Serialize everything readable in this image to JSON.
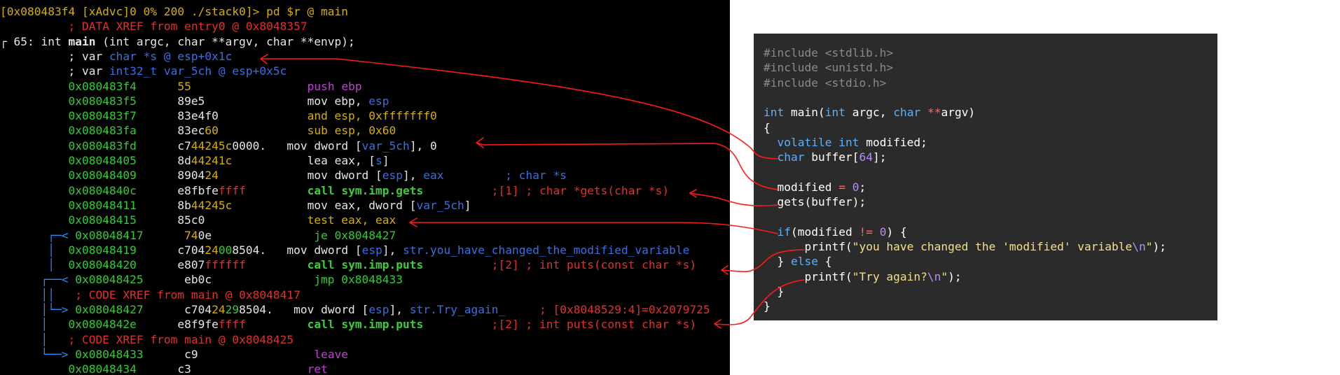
{
  "colors": {
    "terminal_bg": "#000000",
    "code_bg": "#2b2b2b",
    "annotation_red": "#ff1a1a",
    "flow_arrow_blue": "#1e90ff",
    "address_green": "#32cd32",
    "prompt_yellow": "#d7af00",
    "comment_red": "#e0312d",
    "keyword_blue": "#5fafff",
    "mnemonic_purple": "#c040d0",
    "call_green": "#3ccc3c"
  },
  "terminal": {
    "lines": [
      [
        {
          "t": "[0x080483f4 [xAdvc]0 0% 200 ./stack0]> pd $r @ main",
          "c": "#d7af00"
        }
      ],
      [
        {
          "t": "          ",
          "c": "#e6e6e6"
        },
        {
          "t": "; DATA XREF from entry0 @ 0x8048357",
          "c": "#e0312d"
        }
      ],
      [
        {
          "t": "┌ 65: int ",
          "c": "#e6e6e6"
        },
        {
          "t": "main",
          "c": "#e6e6e6",
          "b": true
        },
        {
          "t": " (int argc, char **argv, char **envp);",
          "c": "#e6e6e6"
        }
      ],
      [
        {
          "t": "          ; var ",
          "c": "#e6e6e6"
        },
        {
          "t": "char *s @ esp+0x1c",
          "c": "#3a6fe0"
        }
      ],
      [
        {
          "t": "          ; var ",
          "c": "#e6e6e6"
        },
        {
          "t": "int32_t var_5ch @ esp+0x5c",
          "c": "#3a6fe0"
        }
      ],
      [
        {
          "t": "          ",
          "c": "#e6e6e6"
        },
        {
          "t": "0x080483f4      ",
          "c": "#32cd32"
        },
        {
          "t": "55",
          "c": "#d7af00"
        },
        {
          "t": "                 ",
          "c": "#e6e6e6"
        },
        {
          "t": "push ebp",
          "c": "#c040d0"
        }
      ],
      [
        {
          "t": "          ",
          "c": "#e6e6e6"
        },
        {
          "t": "0x080483f5      ",
          "c": "#32cd32"
        },
        {
          "t": "89e5               mov ebp, ",
          "c": "#e6e6e6"
        },
        {
          "t": "esp",
          "c": "#3a6fe0"
        }
      ],
      [
        {
          "t": "          ",
          "c": "#e6e6e6"
        },
        {
          "t": "0x080483f7      ",
          "c": "#32cd32"
        },
        {
          "t": "83e4f0             ",
          "c": "#e6e6e6"
        },
        {
          "t": "and esp, 0xfffffff0",
          "c": "#d7af00"
        }
      ],
      [
        {
          "t": "          ",
          "c": "#e6e6e6"
        },
        {
          "t": "0x080483fa      ",
          "c": "#32cd32"
        },
        {
          "t": "83ec",
          "c": "#e6e6e6"
        },
        {
          "t": "60",
          "c": "#d7af00"
        },
        {
          "t": "             ",
          "c": "#e6e6e6"
        },
        {
          "t": "sub esp, 0x60",
          "c": "#d7af00"
        }
      ],
      [
        {
          "t": "          ",
          "c": "#e6e6e6"
        },
        {
          "t": "0x080483fd      ",
          "c": "#32cd32"
        },
        {
          "t": "c7",
          "c": "#e6e6e6"
        },
        {
          "t": "44245c",
          "c": "#d7af00"
        },
        {
          "t": "0000.",
          "c": "#e6e6e6"
        },
        {
          "t": "   mov dword [",
          "c": "#e6e6e6"
        },
        {
          "t": "var_5ch",
          "c": "#3a6fe0"
        },
        {
          "t": "], 0",
          "c": "#e6e6e6"
        }
      ],
      [
        {
          "t": "          ",
          "c": "#e6e6e6"
        },
        {
          "t": "0x08048405      ",
          "c": "#32cd32"
        },
        {
          "t": "8d",
          "c": "#e6e6e6"
        },
        {
          "t": "44241c",
          "c": "#d7af00"
        },
        {
          "t": "           lea eax, [",
          "c": "#e6e6e6"
        },
        {
          "t": "s",
          "c": "#3a6fe0"
        },
        {
          "t": "]",
          "c": "#e6e6e6"
        }
      ],
      [
        {
          "t": "          ",
          "c": "#e6e6e6"
        },
        {
          "t": "0x08048409      ",
          "c": "#32cd32"
        },
        {
          "t": "8904",
          "c": "#e6e6e6"
        },
        {
          "t": "24",
          "c": "#d7af00"
        },
        {
          "t": "             mov dword [",
          "c": "#e6e6e6"
        },
        {
          "t": "esp",
          "c": "#3a6fe0"
        },
        {
          "t": "], ",
          "c": "#e6e6e6"
        },
        {
          "t": "eax",
          "c": "#3a6fe0"
        },
        {
          "t": "         ",
          "c": "#e6e6e6"
        },
        {
          "t": "; char *s",
          "c": "#3a6fe0"
        }
      ],
      [
        {
          "t": "          ",
          "c": "#e6e6e6"
        },
        {
          "t": "0x0804840c      ",
          "c": "#32cd32"
        },
        {
          "t": "e8fbfe",
          "c": "#e6e6e6"
        },
        {
          "t": "ffff",
          "c": "#e0312d"
        },
        {
          "t": "         ",
          "c": "#e6e6e6"
        },
        {
          "t": "call sym.imp.gets",
          "c": "#3ccc3c",
          "b": true
        },
        {
          "t": "          ",
          "c": "#e6e6e6"
        },
        {
          "t": ";[1] ; char *gets(char *s)",
          "c": "#e0312d"
        }
      ],
      [
        {
          "t": "          ",
          "c": "#e6e6e6"
        },
        {
          "t": "0x08048411      ",
          "c": "#32cd32"
        },
        {
          "t": "8b",
          "c": "#e6e6e6"
        },
        {
          "t": "44245c",
          "c": "#d7af00"
        },
        {
          "t": "           mov eax, dword [",
          "c": "#e6e6e6"
        },
        {
          "t": "var_5ch",
          "c": "#3a6fe0"
        },
        {
          "t": "]",
          "c": "#e6e6e6"
        }
      ],
      [
        {
          "t": "          ",
          "c": "#e6e6e6"
        },
        {
          "t": "0x08048415      ",
          "c": "#32cd32"
        },
        {
          "t": "85c0",
          "c": "#e6e6e6"
        },
        {
          "t": "               ",
          "c": "#e6e6e6"
        },
        {
          "t": "test eax, eax",
          "c": "#d7af00"
        }
      ],
      [
        {
          "t": "       ┌─< ",
          "c": "#1e90ff"
        },
        {
          "t": "0x08048417      ",
          "c": "#32cd32"
        },
        {
          "t": "74",
          "c": "#d7af00"
        },
        {
          "t": "0e",
          "c": "#e6e6e6"
        },
        {
          "t": "               ",
          "c": "#e6e6e6"
        },
        {
          "t": "je 0x8048427",
          "c": "#32cd32"
        }
      ],
      [
        {
          "t": "       │  ",
          "c": "#1e90ff"
        },
        {
          "t": "0x08048419      ",
          "c": "#32cd32"
        },
        {
          "t": "c704",
          "c": "#e6e6e6"
        },
        {
          "t": "24",
          "c": "#d7af00"
        },
        {
          "t": "00",
          "c": "#32cd32"
        },
        {
          "t": "8504.",
          "c": "#e6e6e6"
        },
        {
          "t": "   mov dword [",
          "c": "#e6e6e6"
        },
        {
          "t": "esp",
          "c": "#3a6fe0"
        },
        {
          "t": "], ",
          "c": "#e6e6e6"
        },
        {
          "t": "str.you_have_changed_the_modified_variable",
          "c": "#3a6fe0"
        }
      ],
      [
        {
          "t": "       │  ",
          "c": "#1e90ff"
        },
        {
          "t": "0x08048420      ",
          "c": "#32cd32"
        },
        {
          "t": "e807",
          "c": "#e6e6e6"
        },
        {
          "t": "ffffff",
          "c": "#e0312d"
        },
        {
          "t": "         ",
          "c": "#e6e6e6"
        },
        {
          "t": "call sym.imp.puts",
          "c": "#3ccc3c",
          "b": true
        },
        {
          "t": "          ",
          "c": "#e6e6e6"
        },
        {
          "t": ";[2] ; int puts(const char *s)",
          "c": "#e0312d"
        }
      ],
      [
        {
          "t": "      ┌──< ",
          "c": "#1e90ff"
        },
        {
          "t": "0x08048425      ",
          "c": "#32cd32"
        },
        {
          "t": "eb0c",
          "c": "#e6e6e6"
        },
        {
          "t": "               ",
          "c": "#e6e6e6"
        },
        {
          "t": "jmp 0x8048433",
          "c": "#32cd32"
        }
      ],
      [
        {
          "t": "      ││   ",
          "c": "#1e90ff"
        },
        {
          "t": "; CODE XREF from main @ 0x8048417",
          "c": "#e0312d"
        }
      ],
      [
        {
          "t": "      │└─> ",
          "c": "#1e90ff"
        },
        {
          "t": "0x08048427      ",
          "c": "#32cd32"
        },
        {
          "t": "c704",
          "c": "#e6e6e6"
        },
        {
          "t": "24",
          "c": "#d7af00"
        },
        {
          "t": "29",
          "c": "#32cd32"
        },
        {
          "t": "8504.",
          "c": "#e6e6e6"
        },
        {
          "t": "   mov dword [",
          "c": "#e6e6e6"
        },
        {
          "t": "esp",
          "c": "#3a6fe0"
        },
        {
          "t": "], ",
          "c": "#e6e6e6"
        },
        {
          "t": "str.Try_again_",
          "c": "#3a6fe0"
        },
        {
          "t": "     ",
          "c": "#e6e6e6"
        },
        {
          "t": "; [0x8048529:4]=0x2079725",
          "c": "#e0312d"
        }
      ],
      [
        {
          "t": "      │   ",
          "c": "#1e90ff"
        },
        {
          "t": "0x0804842e      ",
          "c": "#32cd32"
        },
        {
          "t": "e8f9fe",
          "c": "#e6e6e6"
        },
        {
          "t": "ffff",
          "c": "#e0312d"
        },
        {
          "t": "         ",
          "c": "#e6e6e6"
        },
        {
          "t": "call sym.imp.puts",
          "c": "#3ccc3c",
          "b": true
        },
        {
          "t": "          ",
          "c": "#e6e6e6"
        },
        {
          "t": ";[2] ; int puts(const char *s)",
          "c": "#e0312d"
        }
      ],
      [
        {
          "t": "      │   ",
          "c": "#1e90ff"
        },
        {
          "t": "; CODE XREF from main @ 0x8048425",
          "c": "#e0312d"
        }
      ],
      [
        {
          "t": "      └──> ",
          "c": "#1e90ff"
        },
        {
          "t": "0x08048433      ",
          "c": "#32cd32"
        },
        {
          "t": "c9",
          "c": "#e6e6e6"
        },
        {
          "t": "                 ",
          "c": "#e6e6e6"
        },
        {
          "t": "leave",
          "c": "#c040d0"
        }
      ],
      [
        {
          "t": "          ",
          "c": "#e6e6e6"
        },
        {
          "t": "0x08048434      ",
          "c": "#32cd32"
        },
        {
          "t": "c3",
          "c": "#e6e6e6"
        },
        {
          "t": "                 ",
          "c": "#e6e6e6"
        },
        {
          "t": "ret",
          "c": "#c040d0"
        }
      ]
    ]
  },
  "source_code": {
    "lines": [
      [
        {
          "t": "#include <stdlib.h>",
          "c": "#8a8a8a"
        }
      ],
      [
        {
          "t": "#include <unistd.h>",
          "c": "#8a8a8a"
        }
      ],
      [
        {
          "t": "#include <stdio.h>",
          "c": "#8a8a8a"
        }
      ],
      [
        {
          "t": "",
          "c": "#ffffff"
        }
      ],
      [
        {
          "t": "int",
          "c": "#5fafff"
        },
        {
          "t": " main(",
          "c": "#ffffff"
        },
        {
          "t": "int",
          "c": "#5fafff"
        },
        {
          "t": " argc, ",
          "c": "#ffffff"
        },
        {
          "t": "char",
          "c": "#5fafff"
        },
        {
          "t": " ",
          "c": "#ffffff"
        },
        {
          "t": "**",
          "c": "#ff6a6a"
        },
        {
          "t": "argv)",
          "c": "#ffffff"
        }
      ],
      [
        {
          "t": "{",
          "c": "#ffffff"
        }
      ],
      [
        {
          "t": "  ",
          "c": "#ffffff"
        },
        {
          "t": "volatile int",
          "c": "#5fafff"
        },
        {
          "t": " modified;",
          "c": "#ffffff"
        }
      ],
      [
        {
          "t": "  ",
          "c": "#ffffff"
        },
        {
          "t": "char",
          "c": "#5fafff"
        },
        {
          "t": " buffer[",
          "c": "#ffffff"
        },
        {
          "t": "64",
          "c": "#b48ef0"
        },
        {
          "t": "];",
          "c": "#ffffff"
        }
      ],
      [
        {
          "t": "",
          "c": "#ffffff"
        }
      ],
      [
        {
          "t": "  modified ",
          "c": "#ffffff"
        },
        {
          "t": "=",
          "c": "#ff6a6a"
        },
        {
          "t": " ",
          "c": "#ffffff"
        },
        {
          "t": "0",
          "c": "#b48ef0"
        },
        {
          "t": ";",
          "c": "#ffffff"
        }
      ],
      [
        {
          "t": "  gets(buffer);",
          "c": "#ffffff"
        }
      ],
      [
        {
          "t": "",
          "c": "#ffffff"
        }
      ],
      [
        {
          "t": "  ",
          "c": "#ffffff"
        },
        {
          "t": "if",
          "c": "#5fafff"
        },
        {
          "t": "(modified ",
          "c": "#ffffff"
        },
        {
          "t": "!=",
          "c": "#ff6a6a"
        },
        {
          "t": " ",
          "c": "#ffffff"
        },
        {
          "t": "0",
          "c": "#b48ef0"
        },
        {
          "t": ") {",
          "c": "#ffffff"
        }
      ],
      [
        {
          "t": "      printf(",
          "c": "#ffffff"
        },
        {
          "t": "\"you have changed the 'modified' variable",
          "c": "#f2e08a"
        },
        {
          "t": "\\n",
          "c": "#b48ef0"
        },
        {
          "t": "\"",
          "c": "#f2e08a"
        },
        {
          "t": ");",
          "c": "#ffffff"
        }
      ],
      [
        {
          "t": "  } ",
          "c": "#ffffff"
        },
        {
          "t": "else",
          "c": "#5fafff"
        },
        {
          "t": " {",
          "c": "#ffffff"
        }
      ],
      [
        {
          "t": "      printf(",
          "c": "#ffffff"
        },
        {
          "t": "\"Try again?",
          "c": "#f2e08a"
        },
        {
          "t": "\\n",
          "c": "#b48ef0"
        },
        {
          "t": "\"",
          "c": "#f2e08a"
        },
        {
          "t": ");",
          "c": "#ffffff"
        }
      ],
      [
        {
          "t": "  }",
          "c": "#ffffff"
        }
      ],
      [
        {
          "t": "}",
          "c": "#ffffff"
        }
      ]
    ]
  }
}
